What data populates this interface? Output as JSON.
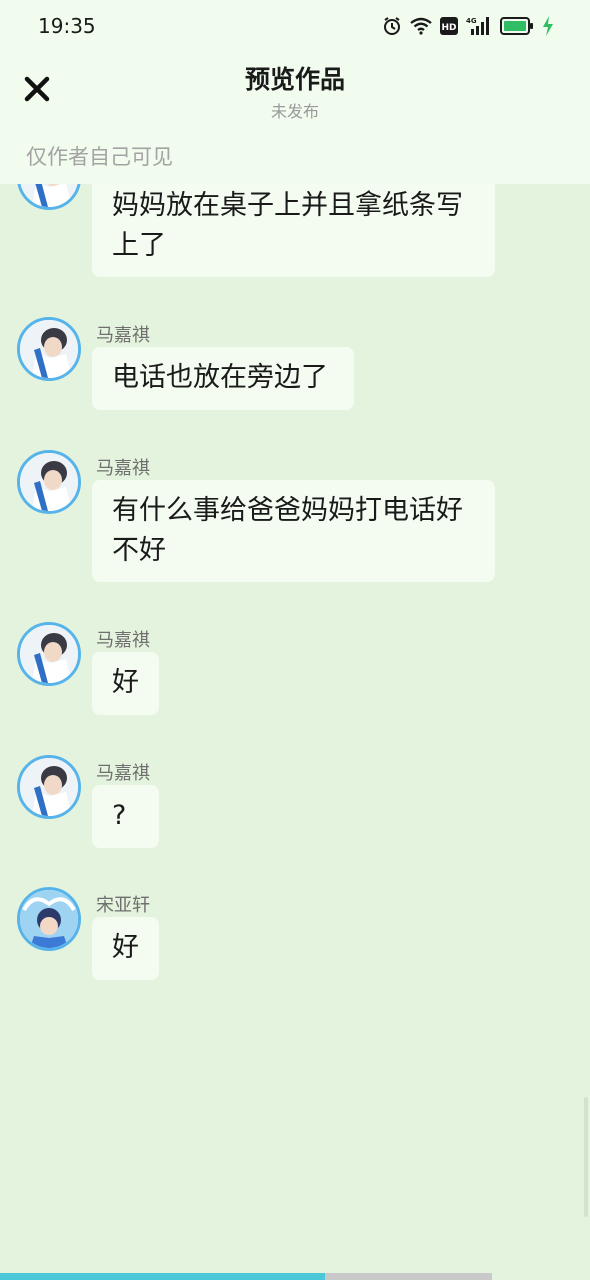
{
  "status_bar": {
    "time": "19:35",
    "icons": [
      "alarm-icon",
      "wifi-icon",
      "hd-icon",
      "signal-4g-icon",
      "battery-icon",
      "charging-icon"
    ]
  },
  "header": {
    "close_icon": "close-icon",
    "title": "预览作品",
    "subtitle": "未发布",
    "visibility": "仅作者自己可见"
  },
  "messages": [
    {
      "text": "妈妈放在桌子上并且拿纸条写上了"
    },
    {
      "sender": "马嘉祺",
      "text": "电话也放在旁边了"
    },
    {
      "sender": "马嘉祺",
      "text": "有什么事给爸爸妈妈打电话好不好"
    },
    {
      "sender": "马嘉祺",
      "text": "好"
    },
    {
      "sender": "马嘉祺",
      "text": "?"
    },
    {
      "sender": "宋亚轩",
      "text": "好"
    }
  ],
  "colors": {
    "background": "#e4f3de",
    "header_bg": "#f1fcee",
    "bubble_bg": "#f4fcf1",
    "avatar_border": "#56b4ea",
    "progress": "#4cc7d8"
  },
  "progress_fraction": 0.55
}
